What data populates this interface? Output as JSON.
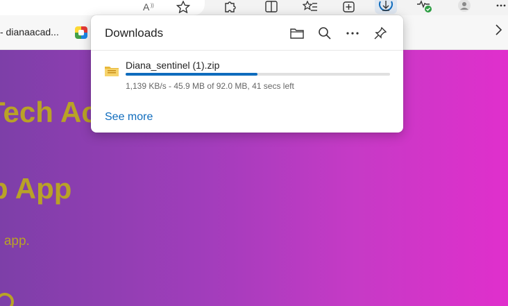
{
  "toolbar": {
    "icons": [
      "read-aloud-icon",
      "favorite-star-icon",
      "extensions-icon",
      "split-screen-icon",
      "favorites-icon",
      "collections-icon",
      "downloads-icon",
      "browser-essentials-icon",
      "profile-icon",
      "more-icon"
    ]
  },
  "favorites_bar": {
    "item_text": "- dianaacad..."
  },
  "page": {
    "heading1": "Tech Ac",
    "heading2": "p App",
    "subtext": "p app."
  },
  "downloads": {
    "title": "Downloads",
    "actions": [
      "open-folder",
      "search",
      "more-options",
      "pin"
    ],
    "items": [
      {
        "file_name": "Diana_sentinel (1).zip",
        "status": "1,139 KB/s - 45.9 MB of 92.0 MB, 41 secs left",
        "progress_fraction": 0.499
      }
    ],
    "see_more_label": "See more"
  },
  "colors": {
    "accent": "#0f6cbd",
    "page_gradient_start": "#7d3fa8",
    "page_gradient_end": "#e02fcc",
    "heading_color": "#b9a227"
  }
}
